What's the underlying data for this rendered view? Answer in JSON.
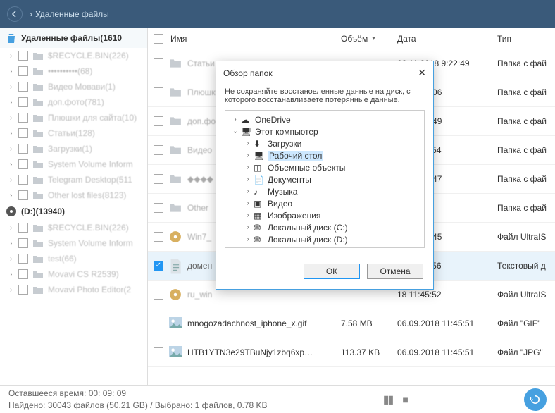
{
  "topbar": {
    "breadcrumb": "Удаленные файлы"
  },
  "sidebar": {
    "title": "Удаленные файлы(1610",
    "items": [
      {
        "label": "$RECYCLE.BIN(226)"
      },
      {
        "label": "••••••••••(68)"
      },
      {
        "label": "Видео Мовави(1)"
      },
      {
        "label": "доп.фото(781)"
      },
      {
        "label": "Плюшки для сайта(10)"
      },
      {
        "label": "Статьи(128)"
      },
      {
        "label": "Загрузки(1)"
      },
      {
        "label": "System Volume Inform"
      },
      {
        "label": "Telegram Desktop(511"
      },
      {
        "label": "Other lost files(8123)"
      }
    ],
    "disk": "(D:)(13940)",
    "disk_items": [
      {
        "label": "$RECYCLE.BIN(226)"
      },
      {
        "label": "System Volume Inform"
      },
      {
        "label": "test(66)"
      },
      {
        "label": "Movavi CS R2539)"
      },
      {
        "label": "Movavi Photo Editor(2"
      }
    ]
  },
  "columns": {
    "name": "Имя",
    "size": "Объём",
    "date": "Дата",
    "type": "Тип"
  },
  "rows": [
    {
      "name": "Статьи",
      "size": "",
      "date": "02.11.2018 9:22:49",
      "type": "Папка с фай",
      "dim": true,
      "icon": "folder"
    },
    {
      "name": "Плюшки",
      "size": "",
      "date": "18 17:55:06",
      "type": "Папка с фай",
      "dim": true,
      "icon": "folder"
    },
    {
      "name": "доп.фо",
      "size": "",
      "date": "18 12:15:49",
      "type": "Папка с фай",
      "dim": true,
      "icon": "folder"
    },
    {
      "name": "Видео",
      "size": "",
      "date": "18 11:44:54",
      "type": "Папка с фай",
      "dim": true,
      "icon": "folder"
    },
    {
      "name": "◆◆◆◆",
      "size": "",
      "date": "18 15:05:47",
      "type": "Папка с фай",
      "dim": true,
      "icon": "folder"
    },
    {
      "name": "Other",
      "size": "",
      "date": "",
      "type": "Папка с фай",
      "dim": true,
      "icon": "folder"
    },
    {
      "name": "Win7_",
      "size": "",
      "date": "18 14:03:45",
      "type": "Файл UltraIS",
      "dim": true,
      "icon": "disc"
    },
    {
      "name": "домен",
      "size": "",
      "date": "18 11:46:56",
      "type": "Текстовый д",
      "checked": true,
      "sel": true,
      "icon": "txt"
    },
    {
      "name": "ru_win",
      "size": "",
      "date": "18 11:45:52",
      "type": "Файл UltraIS",
      "dim": true,
      "icon": "disc"
    },
    {
      "name": "mnogozadachnost_iphone_x.gif",
      "size": "7.58 MB",
      "date": "06.09.2018 11:45:51",
      "type": "Файл \"GIF\"",
      "dark": true,
      "icon": "img"
    },
    {
      "name": "HTB1YTN3e29TBuNjy1zbq6xp…",
      "size": "113.37 KB",
      "date": "06.09.2018 11:45:51",
      "type": "Файл \"JPG\"",
      "dark": true,
      "icon": "img"
    }
  ],
  "modal": {
    "title": "Обзор папок",
    "message": "Не сохраняйте восстановленные данные на диск, с которого восстанавливаете потерянные данные.",
    "tree": [
      {
        "depth": 0,
        "exp": ">",
        "icon": "cloud",
        "label": "OneDrive"
      },
      {
        "depth": 0,
        "exp": "v",
        "icon": "pc",
        "label": "Этот компьютер"
      },
      {
        "depth": 1,
        "exp": ">",
        "icon": "down",
        "label": "Загрузки"
      },
      {
        "depth": 1,
        "exp": ">",
        "icon": "desk",
        "label": "Рабочий стол",
        "sel": true
      },
      {
        "depth": 1,
        "exp": ">",
        "icon": "cube",
        "label": "Объемные объекты"
      },
      {
        "depth": 1,
        "exp": ">",
        "icon": "doc",
        "label": "Документы"
      },
      {
        "depth": 1,
        "exp": ">",
        "icon": "music",
        "label": "Музыка"
      },
      {
        "depth": 1,
        "exp": ">",
        "icon": "video",
        "label": "Видео"
      },
      {
        "depth": 1,
        "exp": ">",
        "icon": "pic",
        "label": "Изображения"
      },
      {
        "depth": 1,
        "exp": ">",
        "icon": "hdd",
        "label": "Локальный диск (C:)"
      },
      {
        "depth": 1,
        "exp": ">",
        "icon": "hdd",
        "label": "Локальный диск (D:)"
      }
    ],
    "ok": "ОК",
    "cancel": "Отмена"
  },
  "footer": {
    "line1": "Оставшееся время: 00: 09: 09",
    "line2": "Найдено: 30043 файлов (50.21 GB) / Выбрано: 1 файлов, 0.78 KB"
  }
}
